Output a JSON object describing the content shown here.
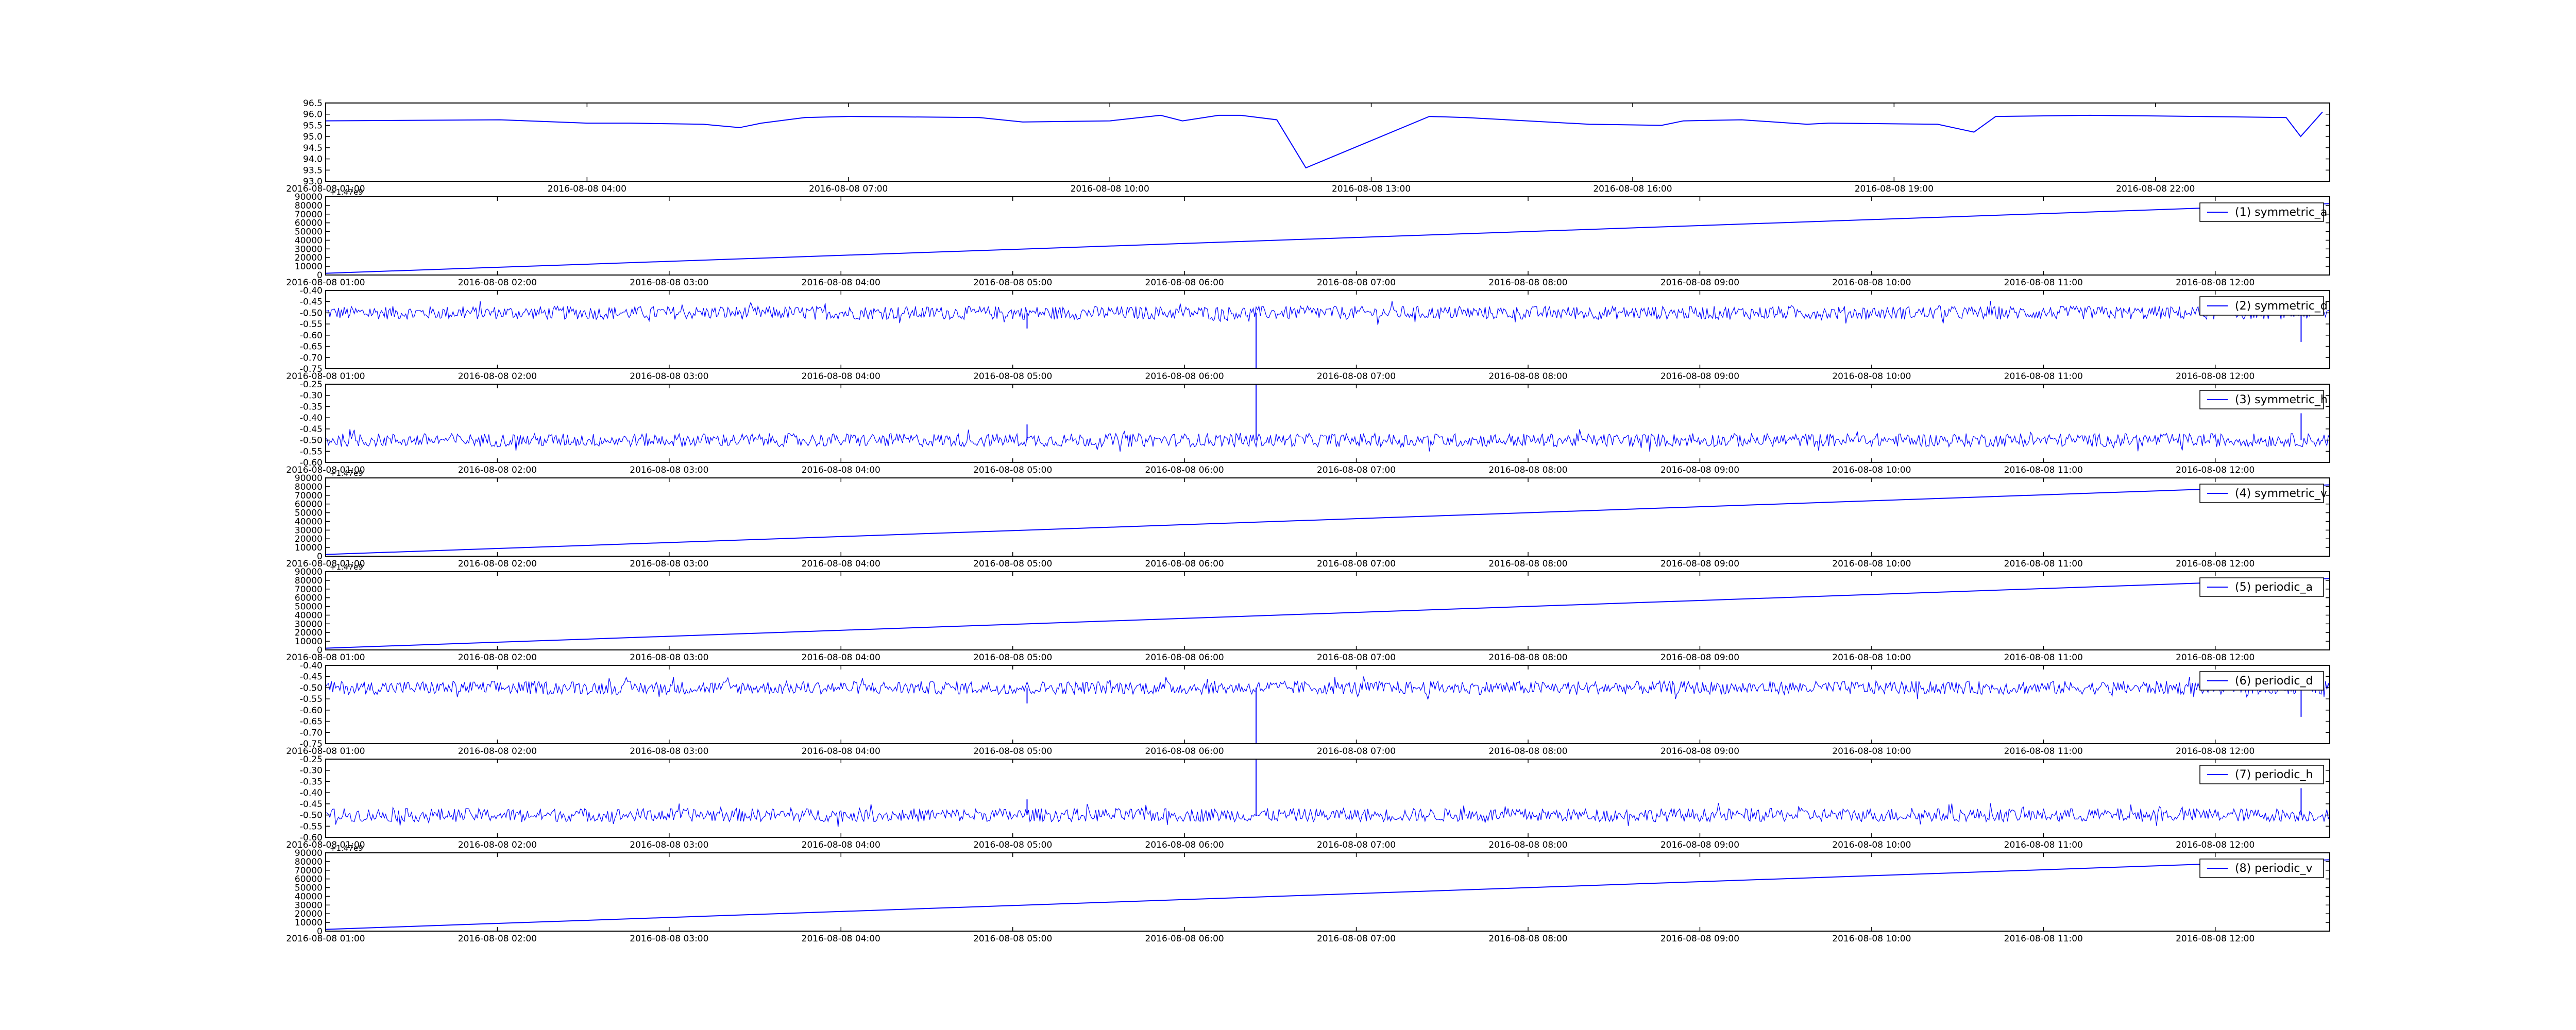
{
  "chart_data": [
    {
      "type": "line",
      "color": "#0000ff",
      "ylim": [
        93.0,
        96.5
      ],
      "yticks": [
        "96.5",
        "96.0",
        "95.5",
        "95.0",
        "94.5",
        "94.0",
        "93.5",
        "93.0"
      ],
      "x_range": [
        "2016-08-08 01:00",
        "2016-08-09 00:00"
      ],
      "xticks": [
        "2016-08-08 01:00",
        "2016-08-08 04:00",
        "2016-08-08 07:00",
        "2016-08-08 10:00",
        "2016-08-08 13:00",
        "2016-08-08 16:00",
        "2016-08-08 19:00",
        "2016-08-08 22:00"
      ],
      "series": [
        {
          "x": [
            "01:00",
            "03:00",
            "04:00",
            "04:30",
            "05:20",
            "05:45",
            "06:00",
            "06:30",
            "07:00",
            "08:30",
            "09:00",
            "10:00",
            "10:35",
            "10:50",
            "11:15",
            "11:30",
            "11:55",
            "12:15",
            "13:40",
            "14:05",
            "15:30",
            "16:20",
            "16:35",
            "17:15",
            "18:00",
            "18:15",
            "19:30",
            "19:55",
            "20:10",
            "21:15",
            "22:30",
            "23:30",
            "23:40",
            "23:55"
          ],
          "y": [
            95.7,
            95.75,
            95.6,
            95.6,
            95.55,
            95.4,
            95.6,
            95.85,
            95.9,
            95.85,
            95.65,
            95.7,
            95.95,
            95.7,
            95.95,
            95.95,
            95.75,
            93.6,
            95.9,
            95.85,
            95.55,
            95.5,
            95.7,
            95.75,
            95.55,
            95.6,
            95.55,
            95.2,
            95.9,
            95.95,
            95.9,
            95.85,
            95.0,
            96.1
          ]
        }
      ]
    },
    {
      "type": "line",
      "color": "#0000ff",
      "offset_text": "+1.47e9",
      "ylim": [
        0,
        90000
      ],
      "yticks": [
        "90000",
        "80000",
        "70000",
        "60000",
        "50000",
        "40000",
        "30000",
        "20000",
        "10000",
        "0"
      ],
      "x_range": [
        "2016-08-08 01:00",
        "2016-08-08 12:40"
      ],
      "xticks": [
        "2016-08-08 01:00",
        "2016-08-08 02:00",
        "2016-08-08 03:00",
        "2016-08-08 04:00",
        "2016-08-08 05:00",
        "2016-08-08 06:00",
        "2016-08-08 07:00",
        "2016-08-08 08:00",
        "2016-08-08 09:00",
        "2016-08-08 10:00",
        "2016-08-08 11:00",
        "2016-08-08 12:00"
      ],
      "legend": "(1) symmetric_a",
      "series": [
        {
          "name": "(1) symmetric_a",
          "x": [
            "01:00",
            "12:40"
          ],
          "y": [
            2000,
            82000
          ]
        }
      ]
    },
    {
      "type": "line",
      "color": "#0000ff",
      "ylim": [
        -0.75,
        -0.4
      ],
      "yticks": [
        "-0.40",
        "-0.45",
        "-0.50",
        "-0.55",
        "-0.60",
        "-0.65",
        "-0.70",
        "-0.75"
      ],
      "x_range": [
        "2016-08-08 01:00",
        "2016-08-08 12:40"
      ],
      "xticks": [
        "2016-08-08 01:00",
        "2016-08-08 02:00",
        "2016-08-08 03:00",
        "2016-08-08 04:00",
        "2016-08-08 05:00",
        "2016-08-08 06:00",
        "2016-08-08 07:00",
        "2016-08-08 08:00",
        "2016-08-08 09:00",
        "2016-08-08 10:00",
        "2016-08-08 11:00",
        "2016-08-08 12:00"
      ],
      "legend": "(2) symmetric_d",
      "series": [
        {
          "name": "(2) symmetric_d",
          "baseline": -0.5,
          "noise": 0.03,
          "spikes": [
            {
              "x": "06:25",
              "y": -0.75
            },
            {
              "x": "12:30",
              "y": -0.63
            },
            {
              "x": "05:05",
              "y": -0.57
            }
          ]
        }
      ]
    },
    {
      "type": "line",
      "color": "#0000ff",
      "ylim": [
        -0.6,
        -0.25
      ],
      "yticks": [
        "-0.25",
        "-0.30",
        "-0.35",
        "-0.40",
        "-0.45",
        "-0.50",
        "-0.55",
        "-0.60"
      ],
      "x_range": [
        "2016-08-08 01:00",
        "2016-08-08 12:40"
      ],
      "xticks": [
        "2016-08-08 01:00",
        "2016-08-08 02:00",
        "2016-08-08 03:00",
        "2016-08-08 04:00",
        "2016-08-08 05:00",
        "2016-08-08 06:00",
        "2016-08-08 07:00",
        "2016-08-08 08:00",
        "2016-08-08 09:00",
        "2016-08-08 10:00",
        "2016-08-08 11:00",
        "2016-08-08 12:00"
      ],
      "legend": "(3) symmetric_h",
      "series": [
        {
          "name": "(3) symmetric_h",
          "baseline": -0.5,
          "noise": 0.03,
          "spikes": [
            {
              "x": "06:25",
              "y": -0.25
            },
            {
              "x": "12:30",
              "y": -0.38
            },
            {
              "x": "05:05",
              "y": -0.43
            }
          ]
        }
      ]
    },
    {
      "type": "line",
      "color": "#0000ff",
      "offset_text": "+1.47e9",
      "ylim": [
        0,
        90000
      ],
      "yticks": [
        "90000",
        "80000",
        "70000",
        "60000",
        "50000",
        "40000",
        "30000",
        "20000",
        "10000",
        "0"
      ],
      "x_range": [
        "2016-08-08 01:00",
        "2016-08-08 12:40"
      ],
      "xticks": [
        "2016-08-08 01:00",
        "2016-08-08 02:00",
        "2016-08-08 03:00",
        "2016-08-08 04:00",
        "2016-08-08 05:00",
        "2016-08-08 06:00",
        "2016-08-08 07:00",
        "2016-08-08 08:00",
        "2016-08-08 09:00",
        "2016-08-08 10:00",
        "2016-08-08 11:00",
        "2016-08-08 12:00"
      ],
      "legend": "(4) symmetric_v",
      "series": [
        {
          "name": "(4) symmetric_v",
          "x": [
            "01:00",
            "12:40"
          ],
          "y": [
            2000,
            82000
          ]
        }
      ]
    },
    {
      "type": "line",
      "color": "#0000ff",
      "offset_text": "+1.47e9",
      "ylim": [
        0,
        90000
      ],
      "yticks": [
        "90000",
        "80000",
        "70000",
        "60000",
        "50000",
        "40000",
        "30000",
        "20000",
        "10000",
        "0"
      ],
      "x_range": [
        "2016-08-08 01:00",
        "2016-08-08 12:40"
      ],
      "xticks": [
        "2016-08-08 01:00",
        "2016-08-08 02:00",
        "2016-08-08 03:00",
        "2016-08-08 04:00",
        "2016-08-08 05:00",
        "2016-08-08 06:00",
        "2016-08-08 07:00",
        "2016-08-08 08:00",
        "2016-08-08 09:00",
        "2016-08-08 10:00",
        "2016-08-08 11:00",
        "2016-08-08 12:00"
      ],
      "legend": "(5) periodic_a",
      "series": [
        {
          "name": "(5) periodic_a",
          "x": [
            "01:00",
            "12:40"
          ],
          "y": [
            2000,
            82000
          ]
        }
      ]
    },
    {
      "type": "line",
      "color": "#0000ff",
      "ylim": [
        -0.75,
        -0.4
      ],
      "yticks": [
        "-0.40",
        "-0.45",
        "-0.50",
        "-0.55",
        "-0.60",
        "-0.65",
        "-0.70",
        "-0.75"
      ],
      "x_range": [
        "2016-08-08 01:00",
        "2016-08-08 12:40"
      ],
      "xticks": [
        "2016-08-08 01:00",
        "2016-08-08 02:00",
        "2016-08-08 03:00",
        "2016-08-08 04:00",
        "2016-08-08 05:00",
        "2016-08-08 06:00",
        "2016-08-08 07:00",
        "2016-08-08 08:00",
        "2016-08-08 09:00",
        "2016-08-08 10:00",
        "2016-08-08 11:00",
        "2016-08-08 12:00"
      ],
      "legend": "(6) periodic_d",
      "series": [
        {
          "name": "(6) periodic_d",
          "baseline": -0.5,
          "noise": 0.03,
          "spikes": [
            {
              "x": "06:25",
              "y": -0.75
            },
            {
              "x": "12:30",
              "y": -0.63
            },
            {
              "x": "05:05",
              "y": -0.57
            }
          ]
        }
      ]
    },
    {
      "type": "line",
      "color": "#0000ff",
      "ylim": [
        -0.6,
        -0.25
      ],
      "yticks": [
        "-0.25",
        "-0.30",
        "-0.35",
        "-0.40",
        "-0.45",
        "-0.50",
        "-0.55",
        "-0.60"
      ],
      "x_range": [
        "2016-08-08 01:00",
        "2016-08-08 12:40"
      ],
      "xticks": [
        "2016-08-08 01:00",
        "2016-08-08 02:00",
        "2016-08-08 03:00",
        "2016-08-08 04:00",
        "2016-08-08 05:00",
        "2016-08-08 06:00",
        "2016-08-08 07:00",
        "2016-08-08 08:00",
        "2016-08-08 09:00",
        "2016-08-08 10:00",
        "2016-08-08 11:00",
        "2016-08-08 12:00"
      ],
      "legend": "(7) periodic_h",
      "series": [
        {
          "name": "(7) periodic_h",
          "baseline": -0.5,
          "noise": 0.03,
          "spikes": [
            {
              "x": "06:25",
              "y": -0.25
            },
            {
              "x": "12:30",
              "y": -0.38
            },
            {
              "x": "05:05",
              "y": -0.43
            }
          ]
        }
      ]
    },
    {
      "type": "line",
      "color": "#0000ff",
      "offset_text": "+1.47e9",
      "ylim": [
        0,
        90000
      ],
      "yticks": [
        "90000",
        "80000",
        "70000",
        "60000",
        "50000",
        "40000",
        "30000",
        "20000",
        "10000",
        "0"
      ],
      "x_range": [
        "2016-08-08 01:00",
        "2016-08-08 12:40"
      ],
      "xticks": [
        "2016-08-08 01:00",
        "2016-08-08 02:00",
        "2016-08-08 03:00",
        "2016-08-08 04:00",
        "2016-08-08 05:00",
        "2016-08-08 06:00",
        "2016-08-08 07:00",
        "2016-08-08 08:00",
        "2016-08-08 09:00",
        "2016-08-08 10:00",
        "2016-08-08 11:00",
        "2016-08-08 12:00"
      ],
      "legend": "(8) periodic_v",
      "series": [
        {
          "name": "(8) periodic_v",
          "x": [
            "01:00",
            "12:40"
          ],
          "y": [
            2000,
            82000
          ]
        }
      ]
    }
  ]
}
